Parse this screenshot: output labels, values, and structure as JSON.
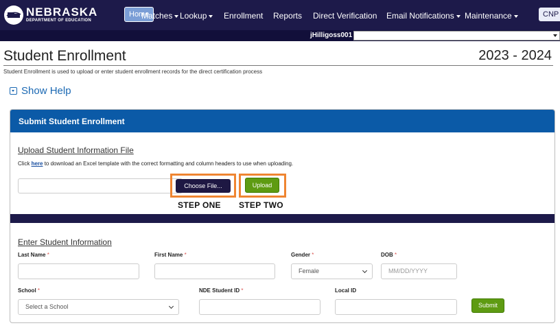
{
  "brand": {
    "name": "NEBRASKA",
    "subtitle": "DEPARTMENT OF EDUCATION"
  },
  "nav": {
    "home": "Home",
    "items": [
      {
        "label": "Matches",
        "dropdown": true
      },
      {
        "label": "Lookup",
        "dropdown": true
      },
      {
        "label": "Enrollment",
        "dropdown": false
      },
      {
        "label": "Reports",
        "dropdown": false
      },
      {
        "label": "Direct Verification",
        "dropdown": false
      },
      {
        "label": "Email Notifications",
        "dropdown": true
      },
      {
        "label": "Maintenance",
        "dropdown": true
      }
    ],
    "cnp": "CNP"
  },
  "user": {
    "username": "jHilligoss001 -",
    "selected": ""
  },
  "page": {
    "title": "Student Enrollment",
    "year": "2023 - 2024",
    "description": "Student Enrollment is used to upload or enter student enrollment records for the direct certification process",
    "show_help": "Show Help"
  },
  "panel": {
    "title": "Submit Student Enrollment",
    "upload": {
      "title": "Upload Student Information File",
      "instr_before": "Click ",
      "instr_link": "here",
      "instr_after": " to download an Excel template with the correct formatting and column headers to use when uploading.",
      "file_value": "",
      "choose_label": "Choose File...",
      "upload_label": "Upload",
      "step_one": "STEP ONE",
      "step_two": "STEP TWO"
    },
    "enter": {
      "title": "Enter Student Information",
      "last_name_label": "Last Name",
      "first_name_label": "First Name",
      "gender_label": "Gender",
      "gender_value": "Female",
      "dob_label": "DOB",
      "dob_placeholder": "MM/DD/YYYY",
      "school_label": "School",
      "school_value": "Select a School",
      "nde_id_label": "NDE Student ID",
      "local_id_label": "Local ID",
      "required_mark": "*",
      "submit_label": "Submit"
    }
  },
  "colors": {
    "navbar": "#1d1a4a",
    "panel_header": "#0b5aa7",
    "accent_green": "#5e9b12",
    "highlight_orange": "#ef8531",
    "link_blue": "#1a68b3"
  }
}
